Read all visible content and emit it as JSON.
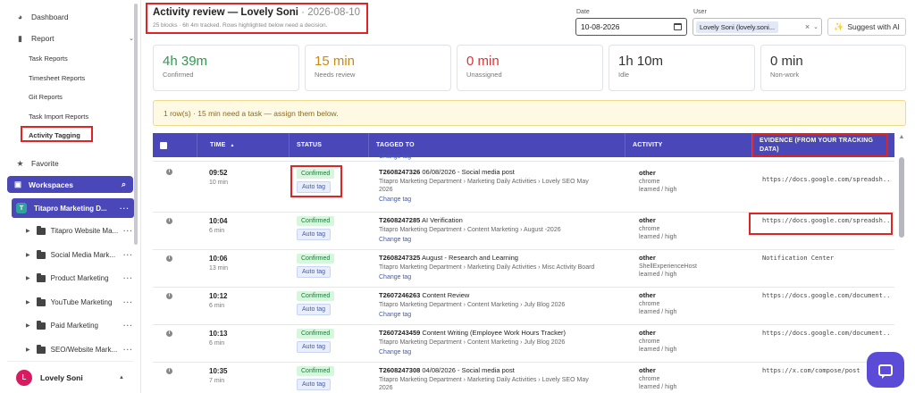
{
  "sidebar": {
    "dashboard": "Dashboard",
    "report": "Report",
    "reports": [
      "Task Reports",
      "Timesheet Reports",
      "Git Reports",
      "Task Import Reports",
      "Activity Tagging"
    ],
    "favorite": "Favorite",
    "workspaces": "Workspaces",
    "selected_workspace": "Titapro Marketing D...",
    "selected_workspace_badge": "T",
    "folders": [
      "Titapro Website Ma...",
      "Social Media Mark...",
      "Product Marketing",
      "YouTube Marketing",
      "Paid Marketing",
      "SEO/Website Mark..."
    ],
    "user_name": "Lovely Soni",
    "user_initial": "L"
  },
  "header": {
    "title": "Activity review — Lovely Soni",
    "title_date": " · 2026-08-10",
    "subtitle": "25 blocks · 6h 4m tracked. Rows highlighted below need a decision.",
    "date_label": "Date",
    "date_value": "10-08-2026",
    "user_label": "User",
    "user_value": "Lovely Soni (lovely.soni...",
    "suggest_label": "Suggest with AI"
  },
  "stats": [
    {
      "value": "4h 39m",
      "caption": "Confirmed",
      "color": "#2e9a4f"
    },
    {
      "value": "15 min",
      "caption": "Needs review",
      "color": "#c98a12"
    },
    {
      "value": "0 min",
      "caption": "Unassigned",
      "color": "#d93636"
    },
    {
      "value": "1h 10m",
      "caption": "Idle",
      "color": "#333333"
    },
    {
      "value": "0 min",
      "caption": "Non-work",
      "color": "#333333"
    }
  ],
  "banner": "1 row(s) · 15 min need a task — assign them below.",
  "table": {
    "headers": {
      "time": "TIME",
      "sort": "▲",
      "status": "STATUS",
      "tagged": "TAGGED TO",
      "activity": "ACTIVITY",
      "evidence": "EVIDENCE (FROM YOUR TRACKING DATA)"
    },
    "partial_change": "Change tag",
    "rows": [
      {
        "time": "09:52",
        "dur": "10 min",
        "status": "Confirmed",
        "auto": "Auto tag",
        "id": "T2608247326",
        "title": "06/08/2026 - Social media post",
        "path": "Titapro Marketing Department › Marketing Daily Activities › Lovely SEO May",
        "path2": "2026",
        "change": "Change tag",
        "app": "other",
        "proc": "chrome",
        "learn": "learned / high",
        "evidence": "https://docs.google.com/spreadsh..."
      },
      {
        "time": "10:04",
        "dur": "6 min",
        "status": "Confirmed",
        "auto": "Auto tag",
        "id": "T2608247285",
        "title": "AI Verification",
        "path": "Titapro Marketing Department › Content Marketing › August -2026",
        "path2": "",
        "change": "Change tag",
        "app": "other",
        "proc": "chrome",
        "learn": "learned / high",
        "evidence": "https://docs.google.com/spreadsh..."
      },
      {
        "time": "10:06",
        "dur": "13 min",
        "status": "Confirmed",
        "auto": "Auto tag",
        "id": "T2608247325",
        "title": "August - Research and Learning",
        "path": "Titapro Marketing Department › Marketing Daily Activities › Misc Activity Board",
        "path2": "",
        "change": "Change tag",
        "app": "other",
        "proc": "ShellExperienceHost",
        "learn": "learned / high",
        "evidence": "Notification Center"
      },
      {
        "time": "10:12",
        "dur": "6 min",
        "status": "Confirmed",
        "auto": "Auto tag",
        "id": "T2607246263",
        "title": "Content Review",
        "path": "Titapro Marketing Department › Content Marketing › July Blog 2026",
        "path2": "",
        "change": "Change tag",
        "app": "other",
        "proc": "chrome",
        "learn": "learned / high",
        "evidence": "https://docs.google.com/document..."
      },
      {
        "time": "10:13",
        "dur": "6 min",
        "status": "Confirmed",
        "auto": "Auto tag",
        "id": "T2607243459",
        "title": "Content Writing (Employee Work Hours Tracker)",
        "path": "Titapro Marketing Department › Content Marketing › July Blog 2026",
        "path2": "",
        "change": "Change tag",
        "app": "other",
        "proc": "chrome",
        "learn": "learned / high",
        "evidence": "https://docs.google.com/document..."
      },
      {
        "time": "10:35",
        "dur": "7 min",
        "status": "Confirmed",
        "auto": "Auto tag",
        "id": "T2608247308",
        "title": "04/08/2026 - Social media post",
        "path": "Titapro Marketing Department › Marketing Daily Activities › Lovely SEO May",
        "path2": "2026",
        "change": "Change tag",
        "app": "other",
        "proc": "chrome",
        "learn": "learned / high",
        "evidence": "https://x.com/compose/post"
      }
    ]
  }
}
